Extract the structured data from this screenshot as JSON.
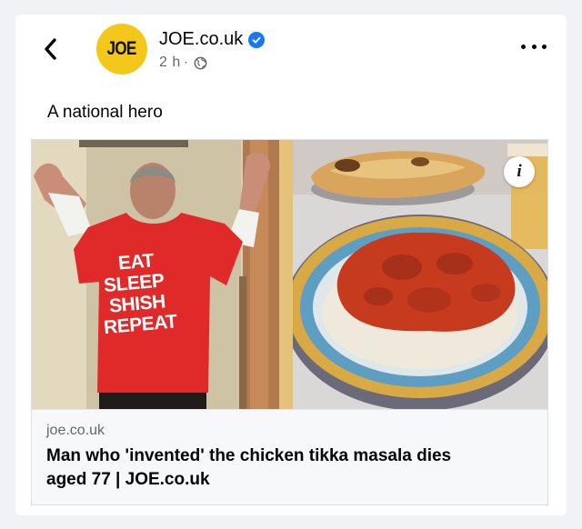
{
  "post": {
    "avatar_text": "JOE",
    "page_name": "JOE.co.uk",
    "time": "2 h",
    "separator": "·",
    "caption": "A national hero",
    "accent_color": "#f4c81a",
    "verified_color": "#1877f2"
  },
  "link_preview": {
    "shirt_lines": [
      "EAT",
      "SLEEP",
      "SHISH",
      "REPEAT"
    ],
    "info_icon_label": "i",
    "domain": "joe.co.uk",
    "headline_line1": "Man who 'invented' the chicken tikka masala dies",
    "headline_line2": "aged 77 | JOE.co.uk"
  }
}
